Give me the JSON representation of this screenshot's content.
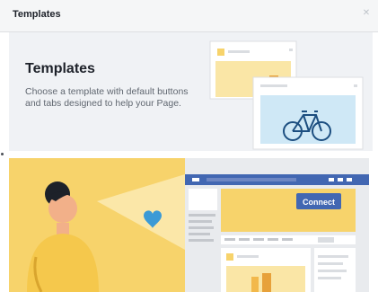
{
  "dialog": {
    "header_title": "Templates",
    "close_icon": "close-icon",
    "intro": {
      "title": "Templates",
      "description": "Choose a template with default buttons and tabs designed to help your Page."
    },
    "preview": {
      "button_label": "Connect"
    }
  },
  "colors": {
    "accent_blue": "#4267b2",
    "header_bg": "#f5f6f7",
    "intro_bg": "#f0f2f5",
    "yellow": "#f7d36b",
    "heart": "#3b9ad6"
  }
}
